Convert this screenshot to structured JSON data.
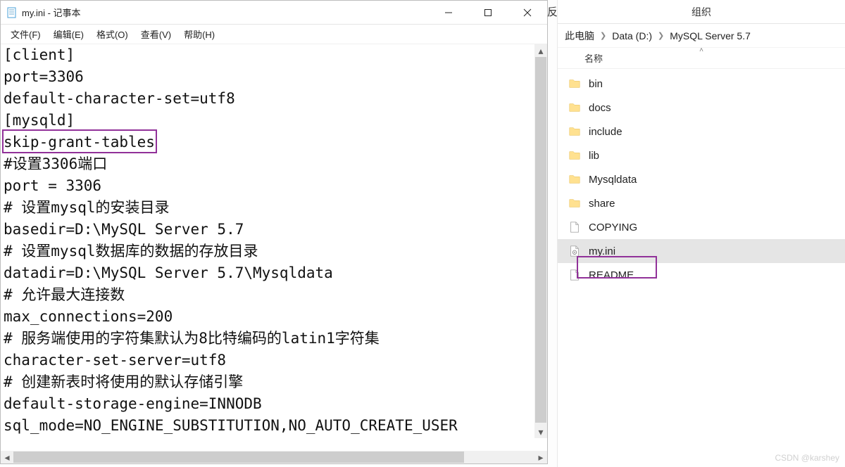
{
  "notepad": {
    "title": "my.ini - 记事本",
    "menu": {
      "file": "文件(F)",
      "edit": "编辑(E)",
      "format": "格式(O)",
      "view": "查看(V)",
      "help": "帮助(H)"
    },
    "lines": [
      "[client]",
      "port=3306",
      "default-character-set=utf8",
      "[mysqld]",
      "skip-grant-tables",
      "#设置3306端口",
      "port = 3306",
      "# 设置mysql的安装目录",
      "basedir=D:\\MySQL Server 5.7",
      "# 设置mysql数据库的数据的存放目录",
      "datadir=D:\\MySQL Server 5.7\\Mysqldata",
      "# 允许最大连接数",
      "max_connections=200",
      "# 服务端使用的字符集默认为8比特编码的latin1字符集",
      "character-set-server=utf8",
      "# 创建新表时将使用的默认存储引擎",
      "default-storage-engine=INNODB",
      "sql_mode=NO_ENGINE_SUBSTITUTION,NO_AUTO_CREATE_USER"
    ]
  },
  "explorer": {
    "sliver_label": "反",
    "top_label": "组织",
    "breadcrumbs": {
      "c1": "此电脑",
      "c2": "Data (D:)",
      "c3": "MySQL Server 5.7"
    },
    "name_header": "名称",
    "items": [
      {
        "name": "bin",
        "type": "folder"
      },
      {
        "name": "docs",
        "type": "folder"
      },
      {
        "name": "include",
        "type": "folder"
      },
      {
        "name": "lib",
        "type": "folder"
      },
      {
        "name": "Mysqldata",
        "type": "folder"
      },
      {
        "name": "share",
        "type": "folder"
      },
      {
        "name": "COPYING",
        "type": "file"
      },
      {
        "name": "my.ini",
        "type": "ini",
        "selected": true
      },
      {
        "name": "README",
        "type": "file"
      }
    ]
  },
  "watermark": "CSDN @karshey"
}
